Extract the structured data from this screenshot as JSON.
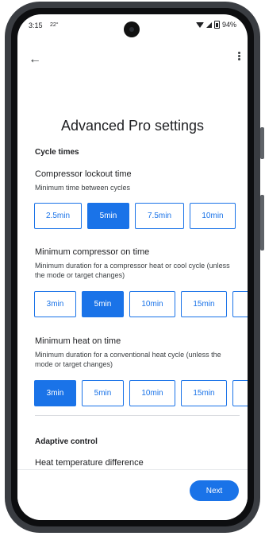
{
  "status_bar": {
    "time": "3:15",
    "temperature": "22°",
    "battery": "94%"
  },
  "header": {
    "back_icon": "arrow-left-icon",
    "menu_icon": "more-vert-icon"
  },
  "page": {
    "title": "Advanced Pro settings"
  },
  "cycle_times": {
    "heading": "Cycle times",
    "compressor_lockout": {
      "title": "Compressor lockout time",
      "description": "Minimum time between cycles",
      "options": [
        "2.5min",
        "5min",
        "7.5min",
        "10min"
      ],
      "selected": "5min"
    },
    "min_compressor_on": {
      "title": "Minimum compressor on time",
      "description": "Minimum duration for a compressor heat or cool cycle (unless the mode or target changes)",
      "options": [
        "3min",
        "5min",
        "10min",
        "15min"
      ],
      "selected": "5min"
    },
    "min_heat_on": {
      "title": "Minimum heat on time",
      "description": "Minimum duration for a conventional heat cycle (unless the mode or target changes)",
      "options": [
        "3min",
        "5min",
        "10min",
        "15min"
      ],
      "selected": "3min"
    }
  },
  "adaptive_control": {
    "heading": "Adaptive control",
    "first_item_title": "Heat temperature difference"
  },
  "footer": {
    "next_label": "Next"
  },
  "colors": {
    "accent": "#1a73e8",
    "text": "#202124"
  }
}
